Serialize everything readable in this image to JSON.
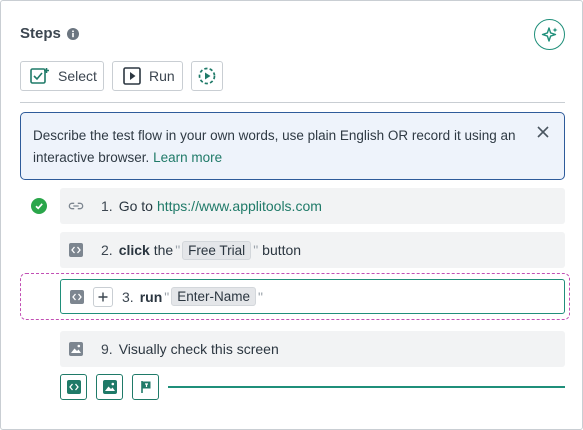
{
  "header": {
    "title": "Steps"
  },
  "toolbar": {
    "select_label": "Select",
    "run_label": "Run"
  },
  "banner": {
    "text": "Describe the test flow in your own words, use plain English OR record it using an interactive browser.",
    "link": "Learn more"
  },
  "steps": [
    {
      "num": "1.",
      "prefix": "Go to",
      "link": "https://www.applitools.com",
      "status": "passed"
    },
    {
      "num": "2.",
      "keyword": "click",
      "mid": "the",
      "value": "Free Trial",
      "suffix": "button"
    },
    {
      "num": "3.",
      "keyword": "run",
      "value": "Enter-Name"
    },
    {
      "num": "9.",
      "text": "Visually check this screen"
    }
  ],
  "colors": {
    "accent": "#1f8f7a",
    "link": "#1f7a68",
    "banner_border": "#2e5b9a",
    "banner_bg": "#eef3fb",
    "success": "#2aa64a",
    "drop_zone": "#c24fb4"
  }
}
